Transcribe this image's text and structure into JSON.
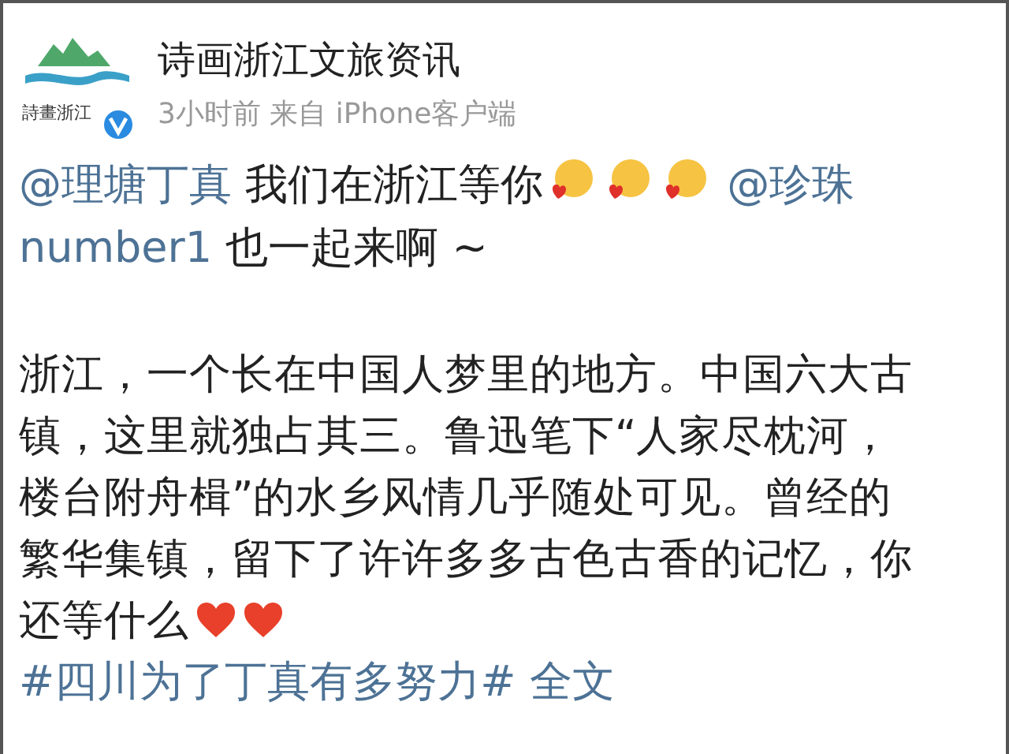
{
  "header": {
    "logo_text": "詩畫浙江",
    "verified": true,
    "name": "诗画浙江文旅资讯",
    "meta": "3小时前 来自 iPhone客户端"
  },
  "post": {
    "lines": [
      [
        {
          "kind": "mention",
          "text": "@理塘丁真"
        },
        {
          "kind": "text",
          "text": " 我们在浙江等你"
        },
        {
          "kind": "emoji"
        },
        {
          "kind": "emoji"
        },
        {
          "kind": "emoji"
        },
        {
          "kind": "mention",
          "text": " @珍珠"
        }
      ],
      [
        {
          "kind": "mention",
          "text": "number1"
        },
        {
          "kind": "text",
          "text": " 也一起来啊 ~"
        }
      ]
    ],
    "paragraph": [
      [
        {
          "kind": "text",
          "text": "浙江，一个长在中国人梦里的地方。中国六大古"
        }
      ],
      [
        {
          "kind": "text",
          "text": "镇，这里就独占其三。鲁迅笔下“人家尽枕河，"
        }
      ],
      [
        {
          "kind": "text",
          "text": "楼台附舟楫”的水乡风情几乎随处可见。曾经的"
        }
      ],
      [
        {
          "kind": "text",
          "text": "繁华集镇，留下了许许多多古色古香的记忆，你"
        }
      ],
      [
        {
          "kind": "text",
          "text": "还等什么"
        },
        {
          "kind": "heart"
        },
        {
          "kind": "heart"
        }
      ]
    ],
    "hashtag": "#四川为了丁真有多努力#",
    "full_text_link": "全文"
  }
}
